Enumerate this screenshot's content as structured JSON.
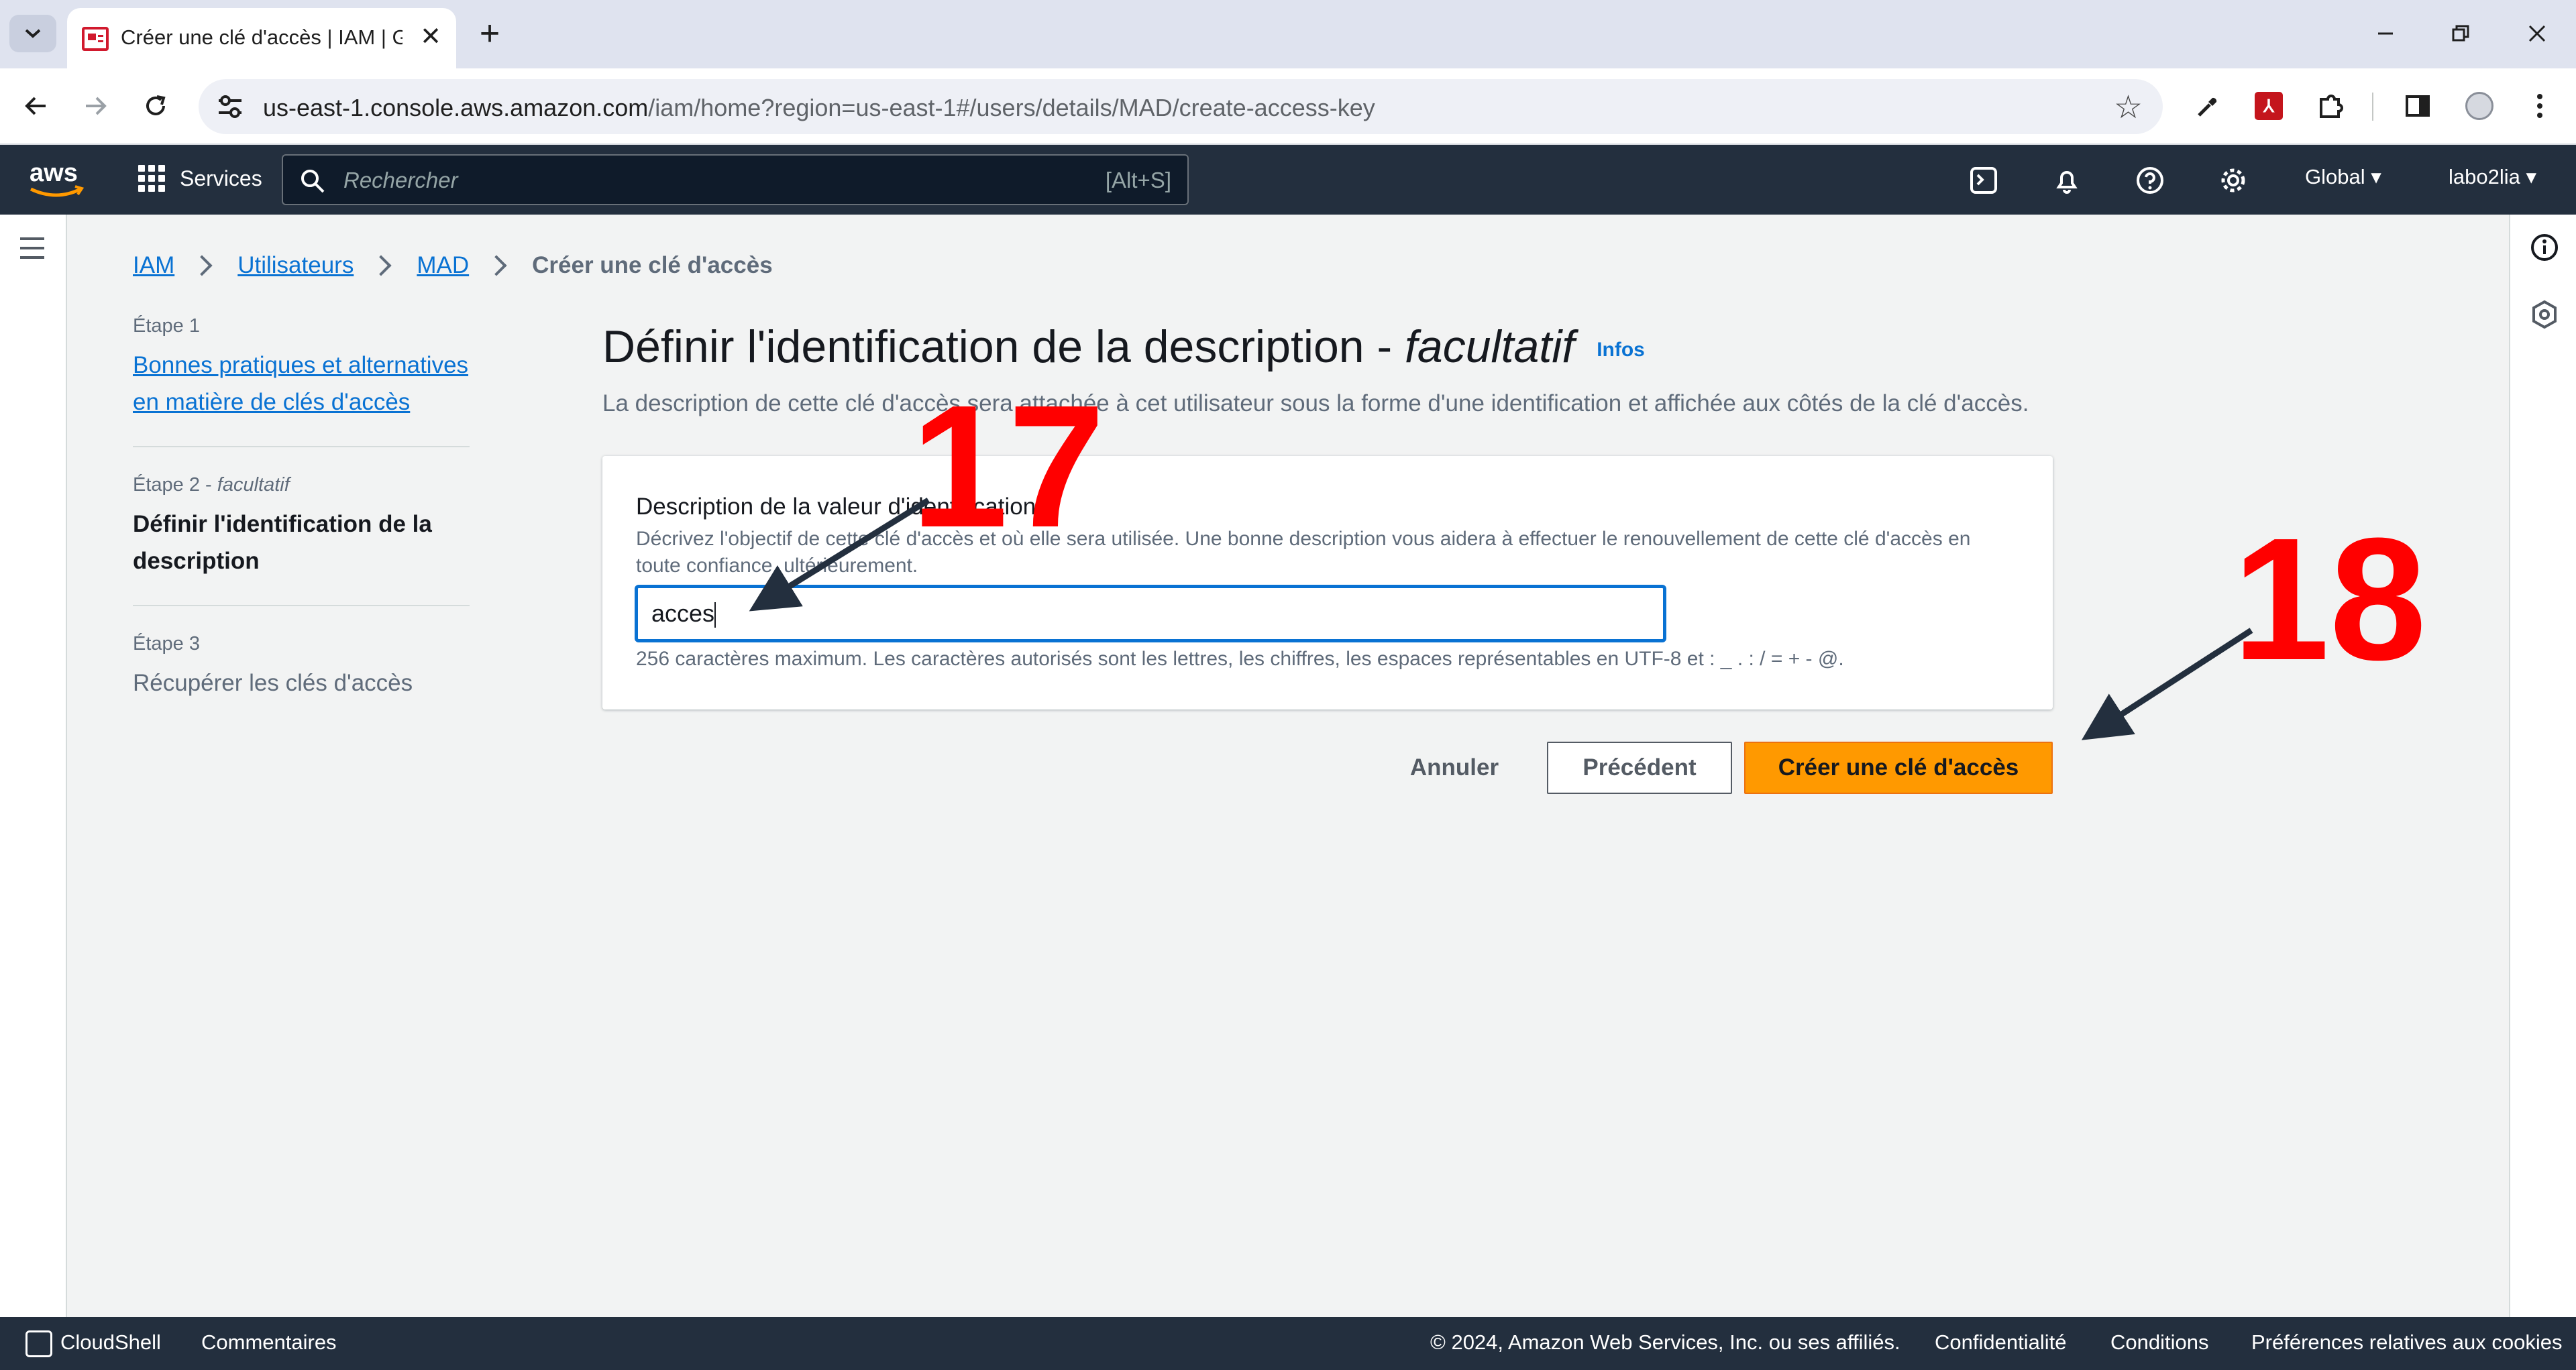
{
  "browser": {
    "tab_title": "Créer une clé d'accès | IAM | Global",
    "url_host": "us-east-1.console.aws.amazon.com",
    "url_path": "/iam/home?region=us-east-1#/users/details/MAD/create-access-key"
  },
  "aws_nav": {
    "services_label": "Services",
    "search_placeholder": "Rechercher",
    "search_shortcut": "[Alt+S]",
    "region_label": "Global",
    "account_label": "labo2lia"
  },
  "breadcrumb": {
    "items": [
      "IAM",
      "Utilisateurs",
      "MAD"
    ],
    "current": "Créer une clé d'accès"
  },
  "steps": [
    {
      "label": "Étape 1",
      "title": "Bonnes pratiques et alternatives en matière de clés d'accès"
    },
    {
      "label": "Étape 2",
      "label_suffix": "facultatif",
      "title": "Définir l'identification de la description"
    },
    {
      "label": "Étape 3",
      "title": "Récupérer les clés d'accès"
    }
  ],
  "main": {
    "title": "Définir l'identification de la description -",
    "title_italic": "facultatif",
    "info_link": "Infos",
    "description": "La description de cette clé d'accès sera attachée à cet utilisateur sous la forme d'une identification et affichée aux côtés de la clé d'accès.",
    "field_label": "Description de la valeur d'identification",
    "field_description": "Décrivez l'objectif de cette clé d'accès et où elle sera utilisée. Une bonne description vous aidera à effectuer le renouvellement de cette clé d'accès en toute confiance, ultérieurement.",
    "field_value": "acces",
    "field_hint": "256 caractères maximum. Les caractères autorisés sont les lettres, les chiffres, les espaces représentables en UTF-8 et : _ . : / = + - @."
  },
  "buttons": {
    "cancel": "Annuler",
    "previous": "Précédent",
    "create": "Créer une clé d'accès"
  },
  "annotations": [
    "17",
    "18"
  ],
  "footer": {
    "cloudshell": "CloudShell",
    "feedback": "Commentaires",
    "copyright": "© 2024, Amazon Web Services, Inc. ou ses affiliés.",
    "privacy": "Confidentialité",
    "terms": "Conditions",
    "cookies": "Préférences relatives aux cookies"
  },
  "colors": {
    "aws_nav": "#232f3e",
    "link": "#0972d3",
    "primary_button": "#ff9900",
    "annotation": "#ff0000"
  }
}
